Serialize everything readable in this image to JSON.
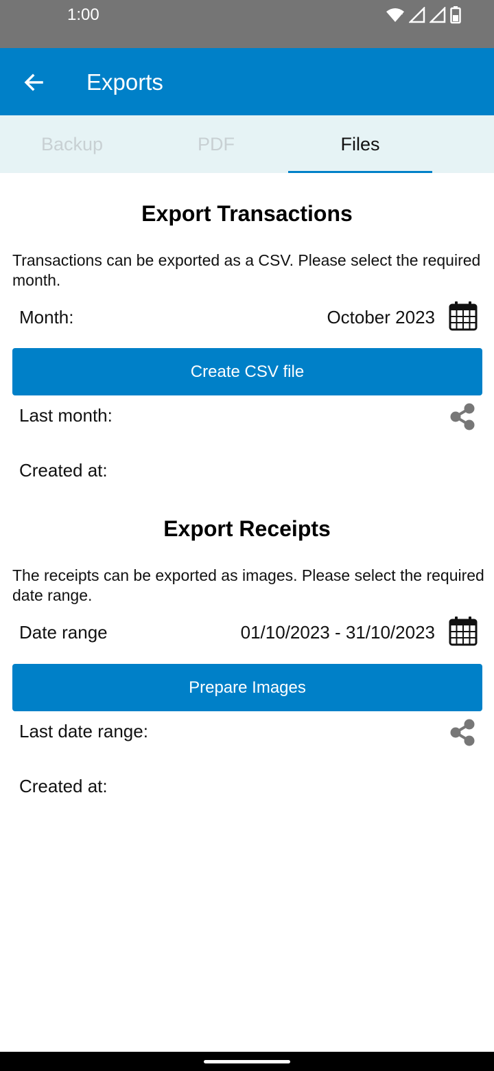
{
  "status_bar": {
    "time": "1:00",
    "icons": [
      "wifi-icon",
      "signal-icon",
      "signal-icon",
      "battery-icon"
    ]
  },
  "app_bar": {
    "back_icon": "arrow-left-icon",
    "title": "Exports"
  },
  "tabs": [
    {
      "label": "Backup",
      "active": false
    },
    {
      "label": "PDF",
      "active": false
    },
    {
      "label": "Files",
      "active": true
    }
  ],
  "transactions": {
    "title": "Export Transactions",
    "description": "Transactions can be exported as a CSV. Please select the required month.",
    "month_label": "Month:",
    "month_value": "October 2023",
    "button_label": "Create CSV file",
    "last_label": "Last month:",
    "created_label": "Created at:"
  },
  "receipts": {
    "title": "Export Receipts",
    "description": "The receipts can be exported as images. Please select the required date range.",
    "range_label": "Date range",
    "range_value": "01/10/2023 - 31/10/2023",
    "button_label": "Prepare Images",
    "last_label": "Last date range:",
    "created_label": "Created at:"
  },
  "colors": {
    "primary": "#0080c8",
    "tab_background": "#e6f3f5",
    "status_bar": "#757575",
    "icon_gray": "#777777"
  }
}
